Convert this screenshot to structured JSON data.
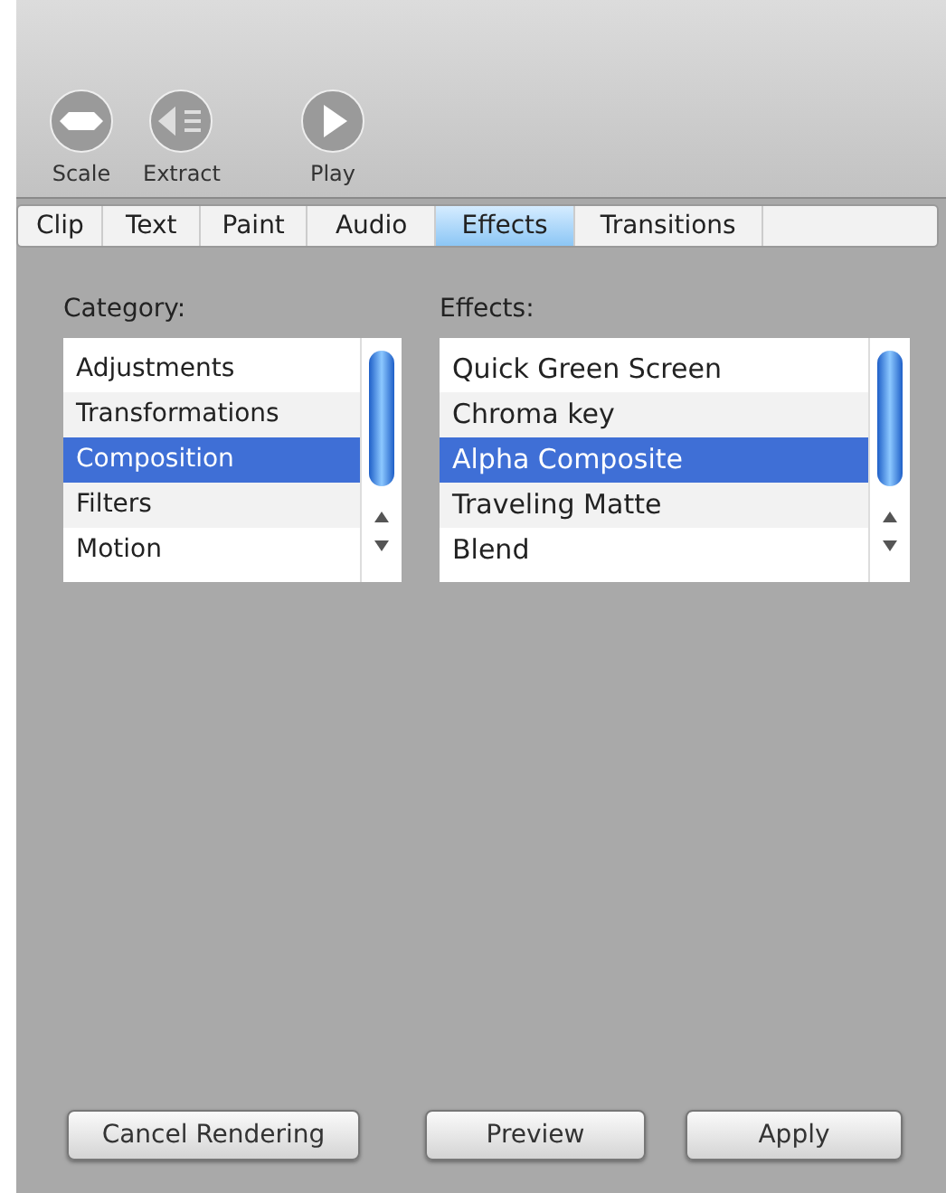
{
  "toolbar": {
    "buttons": [
      {
        "label": "Scale",
        "kind": "scale"
      },
      {
        "label": "Extract",
        "kind": "extract"
      },
      {
        "label": "Play",
        "kind": "play"
      }
    ]
  },
  "tabs": [
    {
      "label": "Clip",
      "selected": false
    },
    {
      "label": "Text",
      "selected": false
    },
    {
      "label": "Paint",
      "selected": false
    },
    {
      "label": "Audio",
      "selected": false
    },
    {
      "label": "Effects",
      "selected": true
    },
    {
      "label": "Transitions",
      "selected": false
    }
  ],
  "category": {
    "label": "Category:",
    "items": [
      {
        "label": "Adjustments",
        "selected": false
      },
      {
        "label": "Transformations",
        "selected": false
      },
      {
        "label": "Composition",
        "selected": true
      },
      {
        "label": "Filters",
        "selected": false
      },
      {
        "label": "Motion",
        "selected": false
      }
    ]
  },
  "effects": {
    "label": "Effects:",
    "items": [
      {
        "label": "Quick Green Screen",
        "selected": false
      },
      {
        "label": "Chroma key",
        "selected": false
      },
      {
        "label": "Alpha Composite",
        "selected": true
      },
      {
        "label": "Traveling Matte",
        "selected": false
      },
      {
        "label": "Blend",
        "selected": false
      }
    ]
  },
  "buttons": [
    "Cancel Rendering",
    "Preview",
    "Apply"
  ]
}
